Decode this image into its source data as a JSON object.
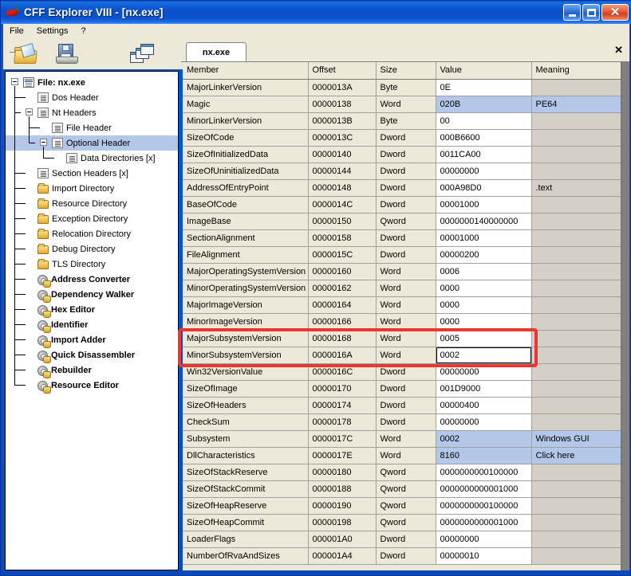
{
  "window": {
    "title": "CFF Explorer VIII - [nx.exe]",
    "icon": "chili-pepper-icon",
    "controls": {
      "minimize": "_",
      "maximize": "□",
      "close": "✕"
    }
  },
  "menubar": {
    "items": [
      "File",
      "Settings",
      "?"
    ]
  },
  "toolbar": {
    "buttons": [
      {
        "name": "open-file",
        "icon": "open-folder-icon"
      },
      {
        "name": "save-file",
        "icon": "floppy-disk-icon"
      },
      {
        "name": "cascade-windows",
        "icon": "cascade-windows-icon"
      }
    ]
  },
  "sidebar": {
    "items": [
      {
        "label": "File: nx.exe",
        "indent": 0,
        "icon": "window-doc-icon",
        "expander": "minus",
        "bold": true,
        "selected": false
      },
      {
        "label": "Dos Header",
        "indent": 1,
        "icon": "page-lines-icon",
        "expander": "none",
        "bold": false,
        "selected": false
      },
      {
        "label": "Nt Headers",
        "indent": 1,
        "icon": "page-lines-icon",
        "expander": "minus",
        "bold": false,
        "selected": false
      },
      {
        "label": "File Header",
        "indent": 2,
        "icon": "page-lines-icon",
        "expander": "none",
        "bold": false,
        "selected": false
      },
      {
        "label": "Optional Header",
        "indent": 2,
        "icon": "page-lines-icon",
        "expander": "minus",
        "bold": false,
        "selected": true
      },
      {
        "label": "Data Directories [x]",
        "indent": 3,
        "icon": "page-lines-icon",
        "expander": "none",
        "bold": false,
        "selected": false
      },
      {
        "label": "Section Headers [x]",
        "indent": 1,
        "icon": "page-lines-icon",
        "expander": "none",
        "bold": false,
        "selected": false
      },
      {
        "label": "Import Directory",
        "indent": 1,
        "icon": "folder-icon",
        "expander": "none",
        "bold": false,
        "selected": false
      },
      {
        "label": "Resource Directory",
        "indent": 1,
        "icon": "folder-icon",
        "expander": "none",
        "bold": false,
        "selected": false
      },
      {
        "label": "Exception Directory",
        "indent": 1,
        "icon": "folder-icon",
        "expander": "none",
        "bold": false,
        "selected": false
      },
      {
        "label": "Relocation Directory",
        "indent": 1,
        "icon": "folder-icon",
        "expander": "none",
        "bold": false,
        "selected": false
      },
      {
        "label": "Debug Directory",
        "indent": 1,
        "icon": "folder-icon",
        "expander": "none",
        "bold": false,
        "selected": false
      },
      {
        "label": "TLS Directory",
        "indent": 1,
        "icon": "folder-icon",
        "expander": "none",
        "bold": false,
        "selected": false
      },
      {
        "label": "Address Converter",
        "indent": 1,
        "icon": "gear-icon",
        "expander": "none",
        "bold": true,
        "selected": false
      },
      {
        "label": "Dependency Walker",
        "indent": 1,
        "icon": "gear-icon",
        "expander": "none",
        "bold": true,
        "selected": false
      },
      {
        "label": "Hex Editor",
        "indent": 1,
        "icon": "gear-icon",
        "expander": "none",
        "bold": true,
        "selected": false
      },
      {
        "label": "Identifier",
        "indent": 1,
        "icon": "gear-icon",
        "expander": "none",
        "bold": true,
        "selected": false
      },
      {
        "label": "Import Adder",
        "indent": 1,
        "icon": "gear-icon",
        "expander": "none",
        "bold": true,
        "selected": false
      },
      {
        "label": "Quick Disassembler",
        "indent": 1,
        "icon": "gear-icon",
        "expander": "none",
        "bold": true,
        "selected": false
      },
      {
        "label": "Rebuilder",
        "indent": 1,
        "icon": "gear-icon",
        "expander": "none",
        "bold": true,
        "selected": false
      },
      {
        "label": "Resource Editor",
        "indent": 1,
        "icon": "gear-icon",
        "expander": "none",
        "bold": true,
        "selected": false
      }
    ]
  },
  "tabs": {
    "items": [
      {
        "label": "nx.exe",
        "active": true
      }
    ],
    "close_label": "✕"
  },
  "grid": {
    "columns": [
      "Member",
      "Offset",
      "Size",
      "Value",
      "Meaning"
    ],
    "rows": [
      {
        "member": "MajorLinkerVersion",
        "offset": "0000013A",
        "size": "Byte",
        "value": "0E",
        "meaning": ""
      },
      {
        "member": "Magic",
        "offset": "00000138",
        "size": "Word",
        "value": "020B",
        "meaning": "PE64",
        "highlighted": true
      },
      {
        "member": "MinorLinkerVersion",
        "offset": "0000013B",
        "size": "Byte",
        "value": "00",
        "meaning": ""
      },
      {
        "member": "SizeOfCode",
        "offset": "0000013C",
        "size": "Dword",
        "value": "000B6600",
        "meaning": ""
      },
      {
        "member": "SizeOfInitializedData",
        "offset": "00000140",
        "size": "Dword",
        "value": "0011CA00",
        "meaning": ""
      },
      {
        "member": "SizeOfUninitializedData",
        "offset": "00000144",
        "size": "Dword",
        "value": "00000000",
        "meaning": ""
      },
      {
        "member": "AddressOfEntryPoint",
        "offset": "00000148",
        "size": "Dword",
        "value": "000A98D0",
        "meaning": ".text"
      },
      {
        "member": "BaseOfCode",
        "offset": "0000014C",
        "size": "Dword",
        "value": "00001000",
        "meaning": ""
      },
      {
        "member": "ImageBase",
        "offset": "00000150",
        "size": "Qword",
        "value": "0000000140000000",
        "meaning": ""
      },
      {
        "member": "SectionAlignment",
        "offset": "00000158",
        "size": "Dword",
        "value": "00001000",
        "meaning": ""
      },
      {
        "member": "FileAlignment",
        "offset": "0000015C",
        "size": "Dword",
        "value": "00000200",
        "meaning": ""
      },
      {
        "member": "MajorOperatingSystemVersion",
        "offset": "00000160",
        "size": "Word",
        "value": "0006",
        "meaning": ""
      },
      {
        "member": "MinorOperatingSystemVersion",
        "offset": "00000162",
        "size": "Word",
        "value": "0000",
        "meaning": ""
      },
      {
        "member": "MajorImageVersion",
        "offset": "00000164",
        "size": "Word",
        "value": "0000",
        "meaning": ""
      },
      {
        "member": "MinorImageVersion",
        "offset": "00000166",
        "size": "Word",
        "value": "0000",
        "meaning": ""
      },
      {
        "member": "MajorSubsystemVersion",
        "offset": "00000168",
        "size": "Word",
        "value": "0005",
        "meaning": ""
      },
      {
        "member": "MinorSubsystemVersion",
        "offset": "0000016A",
        "size": "Word",
        "value": "0002",
        "meaning": "",
        "focused": true
      },
      {
        "member": "Win32VersionValue",
        "offset": "0000016C",
        "size": "Dword",
        "value": "00000000",
        "meaning": ""
      },
      {
        "member": "SizeOfImage",
        "offset": "00000170",
        "size": "Dword",
        "value": "001D9000",
        "meaning": ""
      },
      {
        "member": "SizeOfHeaders",
        "offset": "00000174",
        "size": "Dword",
        "value": "00000400",
        "meaning": ""
      },
      {
        "member": "CheckSum",
        "offset": "00000178",
        "size": "Dword",
        "value": "00000000",
        "meaning": ""
      },
      {
        "member": "Subsystem",
        "offset": "0000017C",
        "size": "Word",
        "value": "0002",
        "meaning": "Windows GUI",
        "highlighted": true
      },
      {
        "member": "DllCharacteristics",
        "offset": "0000017E",
        "size": "Word",
        "value": "8160",
        "meaning": "Click here",
        "highlighted": true
      },
      {
        "member": "SizeOfStackReserve",
        "offset": "00000180",
        "size": "Qword",
        "value": "0000000000100000",
        "meaning": ""
      },
      {
        "member": "SizeOfStackCommit",
        "offset": "00000188",
        "size": "Qword",
        "value": "0000000000001000",
        "meaning": ""
      },
      {
        "member": "SizeOfHeapReserve",
        "offset": "00000190",
        "size": "Qword",
        "value": "0000000000100000",
        "meaning": ""
      },
      {
        "member": "SizeOfHeapCommit",
        "offset": "00000198",
        "size": "Qword",
        "value": "0000000000001000",
        "meaning": ""
      },
      {
        "member": "LoaderFlags",
        "offset": "000001A0",
        "size": "Dword",
        "value": "00000000",
        "meaning": ""
      },
      {
        "member": "NumberOfRvaAndSizes",
        "offset": "000001A4",
        "size": "Dword",
        "value": "00000010",
        "meaning": ""
      }
    ]
  },
  "annotation": {
    "type": "red-rectangle-highlight",
    "color": "#e8382f",
    "targets": [
      "MajorSubsystemVersion",
      "MinorSubsystemVersion"
    ]
  },
  "colors": {
    "titlebar_blue": "#0a52c8",
    "face": "#ece9d8",
    "selection": "#b3c7e8",
    "meaning_disabled": "#d4d0c8",
    "annotation_red": "#e8382f"
  }
}
